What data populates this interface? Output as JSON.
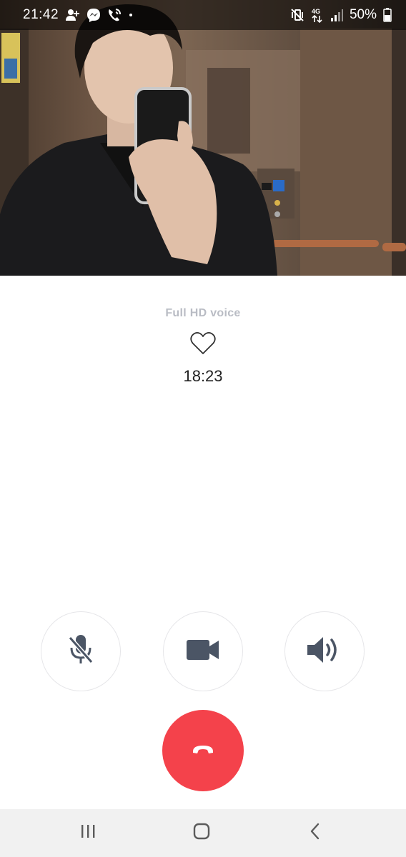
{
  "status_bar": {
    "time": "21:42",
    "battery_percent": "50%",
    "network": "4G",
    "left_icons": [
      "add-contact-icon",
      "messenger-icon",
      "wifi-call-icon",
      "dot-icon"
    ],
    "right_icons": [
      "mute-vibrate-icon",
      "network-4g-icon",
      "signal-icon",
      "battery-icon"
    ]
  },
  "call": {
    "quality_label": "Full HD voice",
    "duration": "18:23",
    "favorite_icon": "heart-outline-icon"
  },
  "controls": {
    "mute_icon": "mic-off-icon",
    "video_icon": "video-camera-icon",
    "speaker_icon": "speaker-icon",
    "end_icon": "phone-hangup-icon"
  },
  "colors": {
    "end_call": "#f4424b",
    "control_icon": "#4b5565",
    "hd_voice_text": "#b9bcc4"
  },
  "nav_bar": {
    "items": [
      "recents-icon",
      "home-icon",
      "back-icon"
    ]
  }
}
